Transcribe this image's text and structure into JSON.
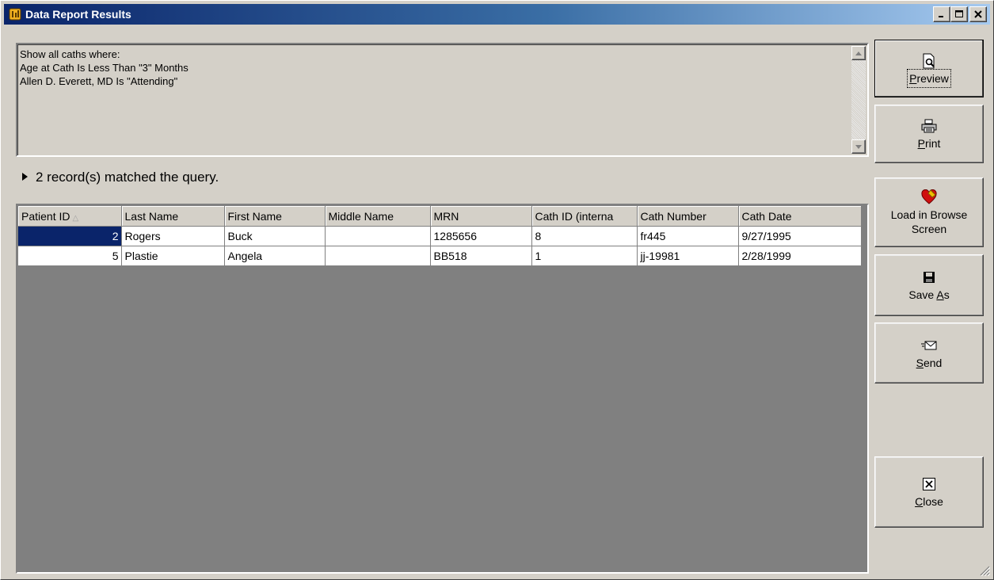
{
  "window": {
    "title": "Data Report Results",
    "controls": {
      "minimize": "_",
      "maximize": "□",
      "close": "×"
    }
  },
  "query": {
    "lines": [
      "Show all caths where:",
      "Age at Cath Is Less Than \"3\" Months",
      "Allen D. Everett, MD Is \"Attending\""
    ]
  },
  "status": {
    "match_text": "2 record(s) matched the query."
  },
  "table": {
    "columns": [
      "Patient ID",
      "Last Name",
      "First Name",
      "Middle Name",
      "MRN",
      "Cath ID (interna",
      "Cath Number",
      "Cath Date"
    ],
    "sort_column": "Patient ID",
    "rows": [
      [
        "2",
        "Rogers",
        "Buck",
        "",
        "1285656",
        "8",
        "fr445",
        "9/27/1995"
      ],
      [
        "5",
        "Plastie",
        "Angela",
        "",
        "BB518",
        "1",
        "jj-19981",
        "2/28/1999"
      ]
    ]
  },
  "buttons": {
    "preview": {
      "pre": "",
      "key": "P",
      "post": "review",
      "icon": "preview-icon"
    },
    "print": {
      "pre": "",
      "key": "P",
      "post": "rint",
      "icon": "printer-icon"
    },
    "load": {
      "line1": "Load in Browse",
      "line2": "Screen",
      "icon": "heart-load-icon"
    },
    "save_as": {
      "pre": "Save ",
      "key": "A",
      "post": "s",
      "icon": "floppy-disk-icon"
    },
    "send": {
      "pre": "",
      "key": "S",
      "post": "end",
      "icon": "send-mail-icon"
    },
    "close": {
      "pre": "",
      "key": "C",
      "post": "lose",
      "icon": "close-box-icon"
    }
  },
  "colors": {
    "title_start": "#0a246a",
    "title_end": "#a6caf0",
    "selection": "#0a246a",
    "face": "#d4d0c8",
    "grid_empty": "#808080"
  }
}
